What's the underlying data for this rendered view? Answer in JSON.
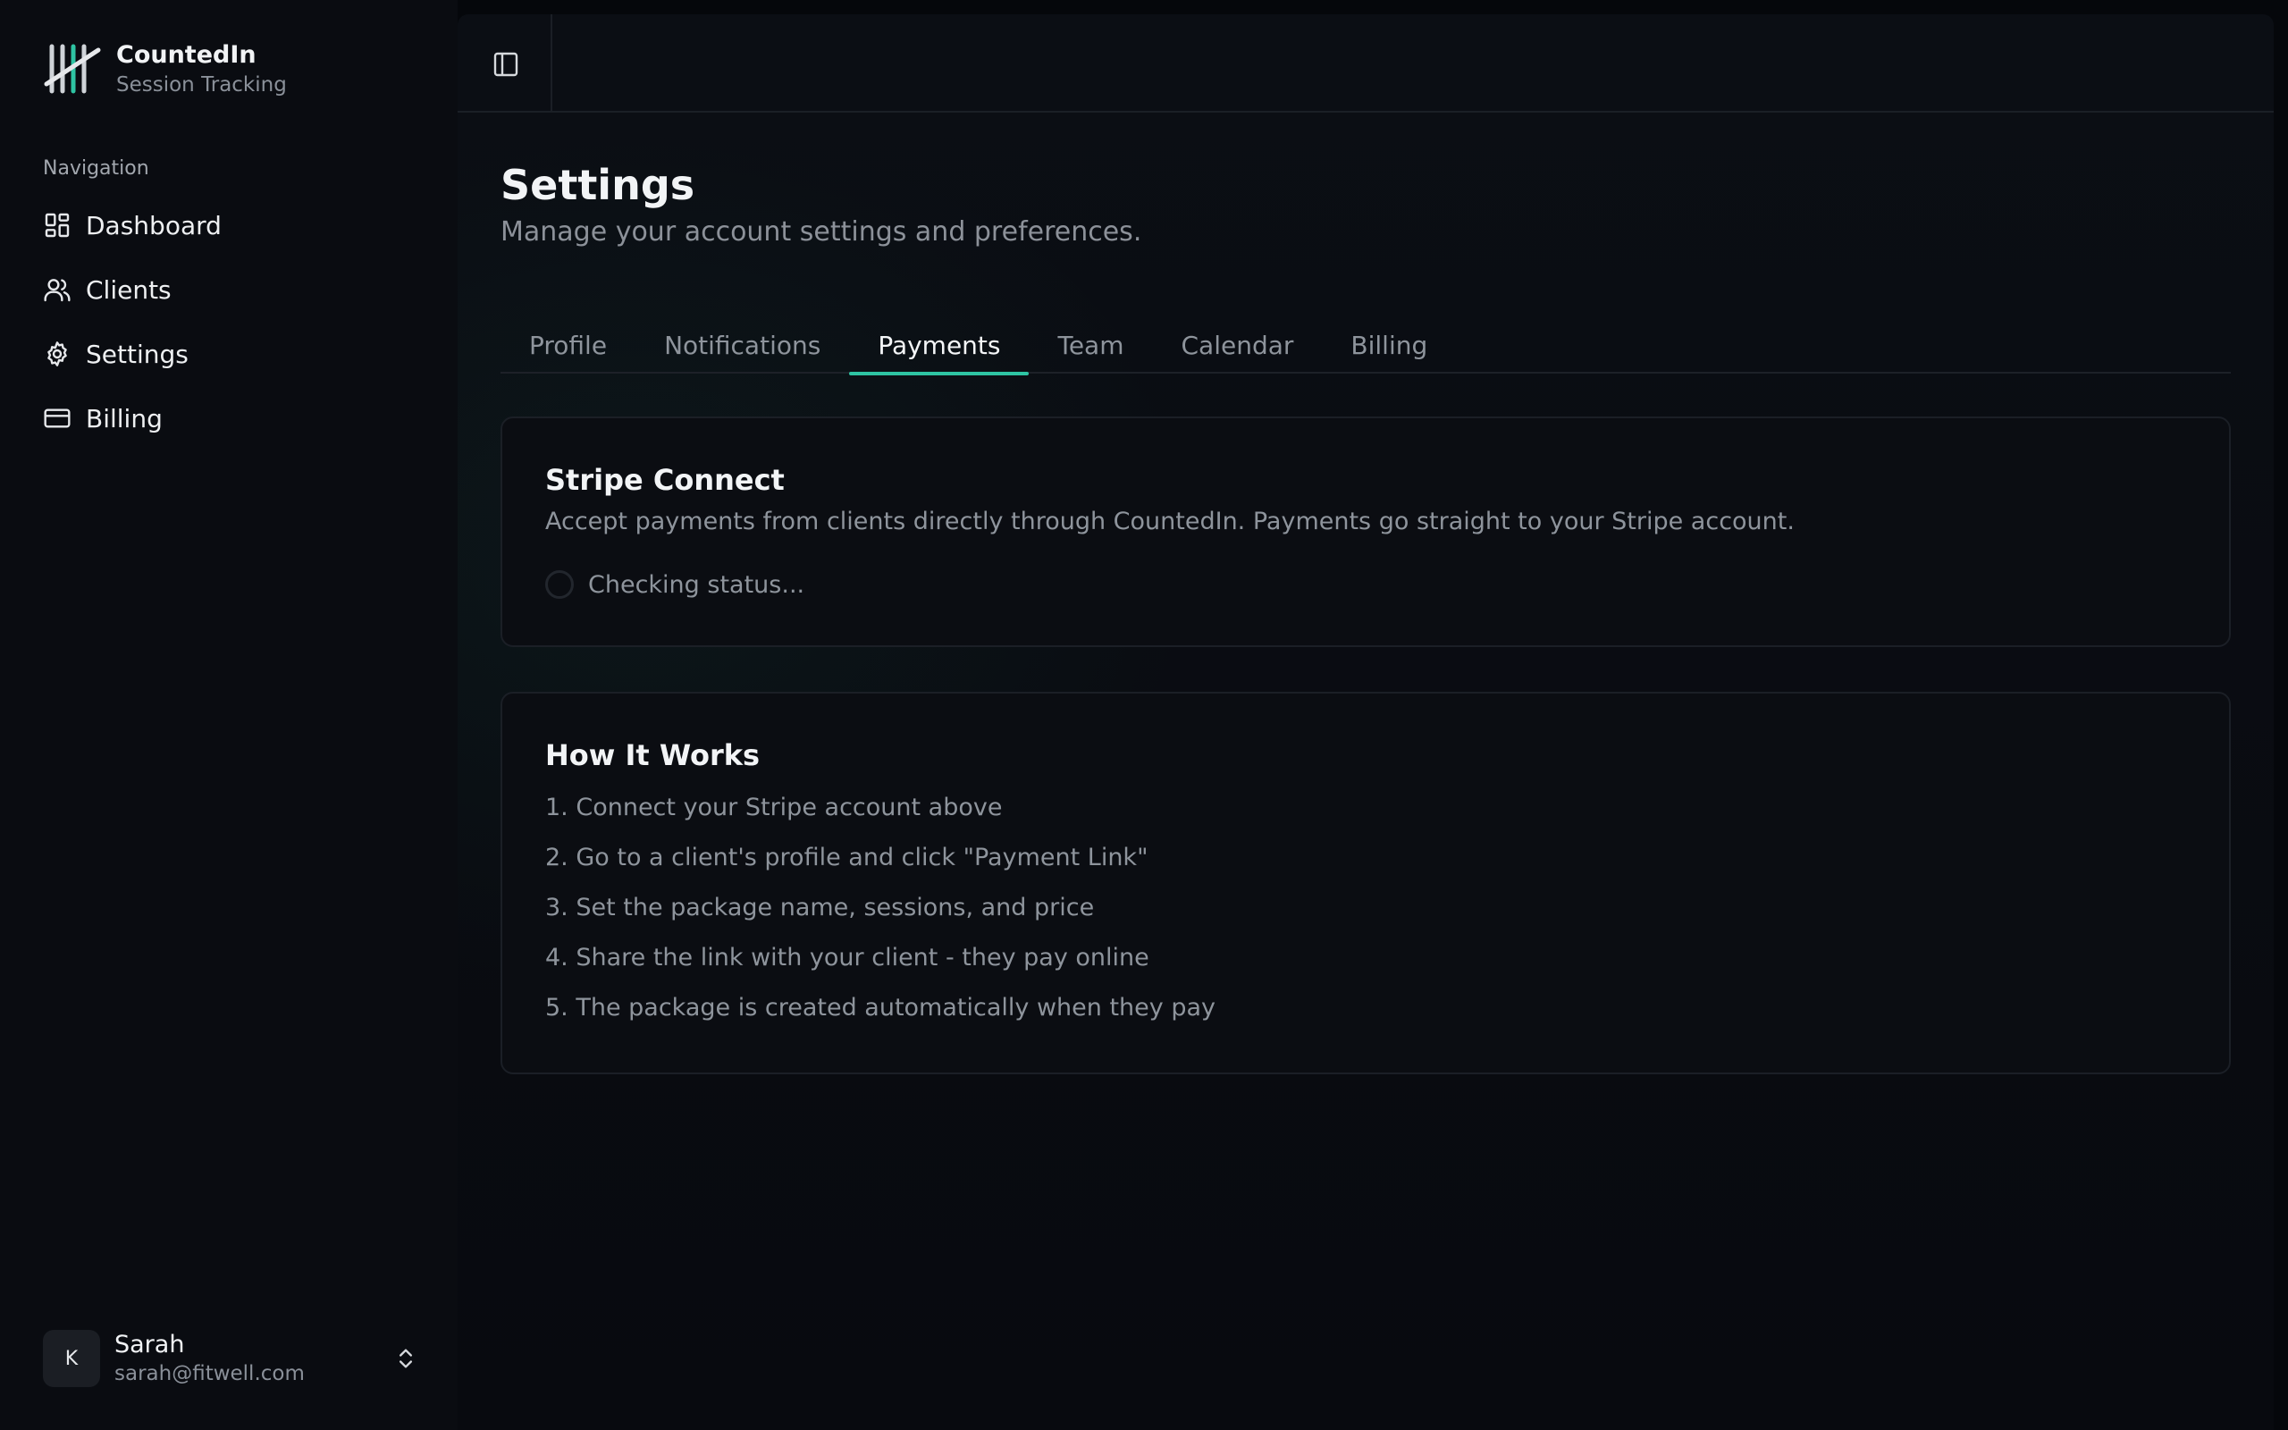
{
  "brand": {
    "name": "CountedIn",
    "subtitle": "Session Tracking"
  },
  "sidebar": {
    "heading": "Navigation",
    "items": [
      {
        "label": "Dashboard",
        "icon": "dashboard-icon"
      },
      {
        "label": "Clients",
        "icon": "users-icon"
      },
      {
        "label": "Settings",
        "icon": "gear-icon"
      },
      {
        "label": "Billing",
        "icon": "credit-card-icon"
      }
    ]
  },
  "user": {
    "initial": "K",
    "name": "Sarah",
    "email": "sarah@fitwell.com"
  },
  "page": {
    "title": "Settings",
    "subtitle": "Manage your account settings and preferences."
  },
  "tabs": [
    {
      "label": "Profile",
      "active": false
    },
    {
      "label": "Notifications",
      "active": false
    },
    {
      "label": "Payments",
      "active": true
    },
    {
      "label": "Team",
      "active": false
    },
    {
      "label": "Calendar",
      "active": false
    },
    {
      "label": "Billing",
      "active": false
    }
  ],
  "stripe": {
    "title": "Stripe Connect",
    "description": "Accept payments from clients directly through CountedIn. Payments go straight to your Stripe account.",
    "status": "Checking status..."
  },
  "how": {
    "title": "How It Works",
    "steps": [
      "1. Connect your Stripe account above",
      "2. Go to a client's profile and click \"Payment Link\"",
      "3. Set the package name, sessions, and price",
      "4. Share the link with your client - they pay online",
      "5. The package is created automatically when they pay"
    ]
  },
  "colors": {
    "accent": "#2ec4a3",
    "background": "#05070b",
    "card": "#0b0d12"
  }
}
